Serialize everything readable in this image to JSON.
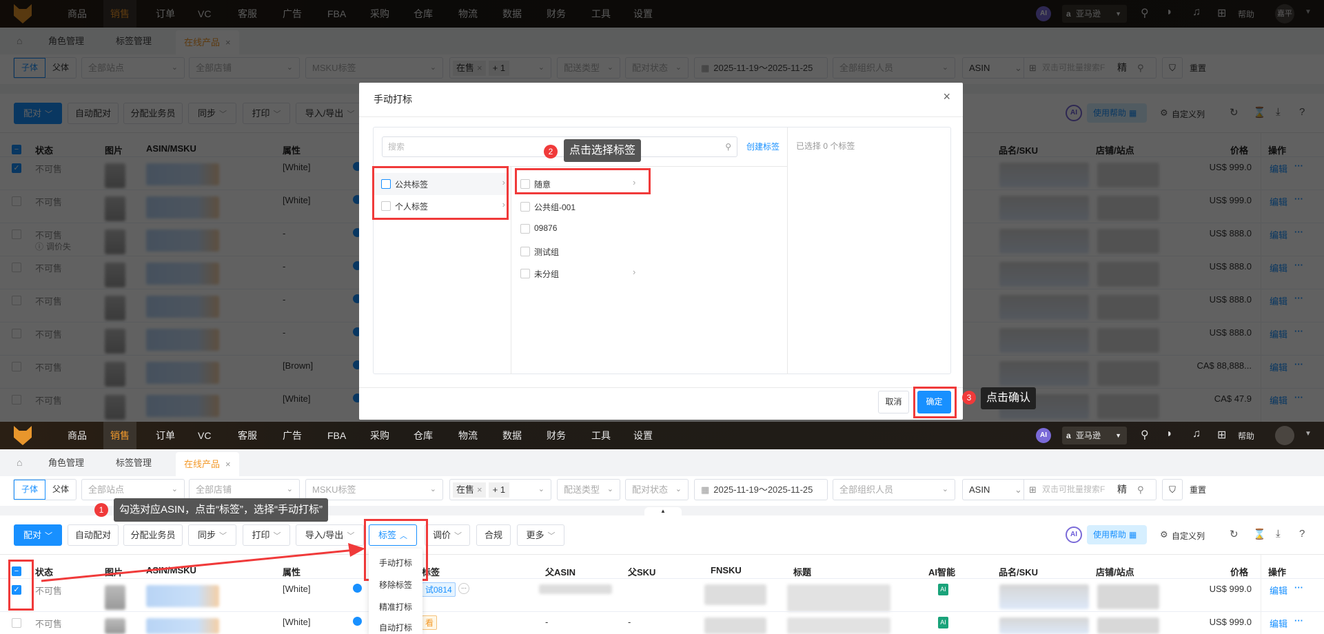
{
  "nav": {
    "items": [
      "商品",
      "销售",
      "订单",
      "VC",
      "客服",
      "广告",
      "FBA",
      "采购",
      "仓库",
      "物流",
      "数据",
      "财务",
      "工具",
      "设置"
    ],
    "active_index": 1,
    "ai": "AI",
    "platform": "亚马逊",
    "help": "帮助",
    "user": "嘉平"
  },
  "tabs": [
    "角色管理",
    "标签管理",
    "在线产品"
  ],
  "filters": {
    "child": "子体",
    "parent": "父体",
    "site": "全部站点",
    "store": "全部店铺",
    "msku": "MSKU标签",
    "status_tag": "在售",
    "status_more": "+ 1",
    "delivery": "配送类型",
    "pair_status": "配对状态",
    "date_range": "2025-11-19～2025-11-25",
    "staff": "全部组织人员",
    "search_type": "ASIN",
    "search_placeholder": "双击可批量搜索F",
    "exact": "精",
    "reset": "重置"
  },
  "toolbar": {
    "buttons": [
      "配对",
      "自动配对",
      "分配业务员",
      "同步",
      "打印",
      "导入/导出",
      "标签",
      "调价",
      "合规",
      "更多"
    ],
    "ai": "AI",
    "help": "使用帮助",
    "custom_columns": "自定义列"
  },
  "columns": [
    "状态",
    "图片",
    "ASIN/MSKU",
    "属性",
    "标签",
    "父ASIN",
    "父SKU",
    "FNSKU",
    "标题",
    "AI智能",
    "品名/SKU",
    "店铺/站点",
    "价格",
    "操作"
  ],
  "top_rows": [
    {
      "status": "不可售",
      "attr": "[White]",
      "price": "US$ 999.0",
      "checked": true
    },
    {
      "status": "不可售",
      "attr": "[White]",
      "price": "US$ 999.0",
      "checked": false
    },
    {
      "status": "不可售",
      "sub": "调价失",
      "attr": "-",
      "price": "US$ 888.0",
      "checked": false
    },
    {
      "status": "不可售",
      "attr": "-",
      "price": "US$ 888.0",
      "checked": false
    },
    {
      "status": "不可售",
      "attr": "-",
      "price": "US$ 888.0",
      "checked": false
    },
    {
      "status": "不可售",
      "attr": "-",
      "price": "US$ 888.0",
      "checked": false
    },
    {
      "status": "不可售",
      "attr": "[Brown]",
      "price": "CA$ 88,888...",
      "checked": false
    },
    {
      "status": "不可售",
      "attr": "[White]",
      "price": "CA$ 47.9",
      "checked": false
    }
  ],
  "bottom_rows": [
    {
      "status": "不可售",
      "attr": "[White]",
      "tag": "试0814",
      "parent_asin": "",
      "parent_sku": "",
      "ai": "AI",
      "price": "US$ 999.0",
      "checked": true
    },
    {
      "status": "不可售",
      "attr": "[White]",
      "tag": "看",
      "parent_asin": "-",
      "parent_sku": "-",
      "ai": "AI",
      "price": "US$ 999.0",
      "checked": false
    }
  ],
  "row_actions": {
    "edit": "编辑",
    "more": "···"
  },
  "modal": {
    "title": "手动打标",
    "search_placeholder": "搜索",
    "create_tag": "创建标签",
    "selected_text": "已选择 0 个标签",
    "categories": [
      "公共标签",
      "个人标签"
    ],
    "groups": [
      {
        "label": "随意",
        "has_children": true
      },
      {
        "label": "公共组-001",
        "has_children": false
      },
      {
        "label": "09876",
        "has_children": false
      },
      {
        "label": "测试组",
        "has_children": false
      },
      {
        "label": "未分组",
        "has_children": true
      }
    ],
    "cancel": "取消",
    "confirm": "确定"
  },
  "tag_menu": [
    "手动打标",
    "移除标签",
    "精准打标",
    "自动打标"
  ],
  "annotations": [
    {
      "num": "1",
      "text": "勾选对应ASIN，点击“标签”，选择“手动打标”"
    },
    {
      "num": "2",
      "text": "点击选择标签"
    },
    {
      "num": "3",
      "text": "点击确认"
    }
  ],
  "colors": {
    "primary": "#1890ff",
    "accent": "#f39a2b",
    "annotation": "#f03a3a"
  }
}
